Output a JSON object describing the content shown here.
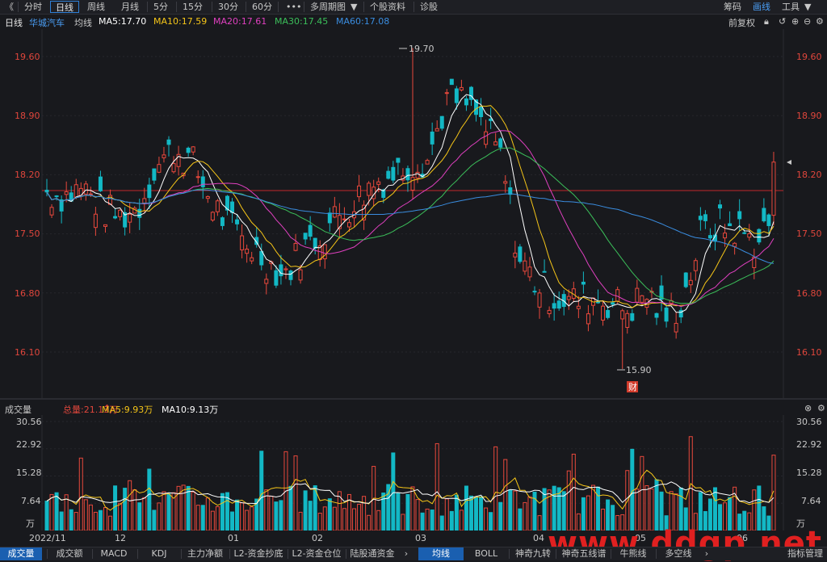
{
  "toolbar": {
    "back": "《",
    "periods": [
      "分时",
      "日线",
      "周线",
      "月线",
      "5分",
      "15分",
      "30分",
      "60分",
      "•••",
      "多周期图",
      "个股资料",
      "诊股"
    ],
    "active_period": "日线",
    "right": [
      "筹码",
      "画线",
      "工具"
    ],
    "right_active": "画线"
  },
  "info": {
    "period": "日线",
    "stock_name": "华城汽车",
    "ma_label": "均线",
    "ma5": "MA5:17.70",
    "ma10": "MA10:17.59",
    "ma20": "MA20:17.61",
    "ma30": "MA30:17.45",
    "ma60": "MA60:17.08",
    "fuquan": "前复权",
    "colors": {
      "ma5": "#ffffff",
      "ma10": "#f5c518",
      "ma20": "#e040c0",
      "ma30": "#3bbf5a",
      "ma60": "#3a8de0"
    }
  },
  "price_axis": [
    "19.60",
    "18.90",
    "18.20",
    "17.50",
    "16.80",
    "16.10"
  ],
  "annotations": {
    "high": "19.70",
    "low": "15.90",
    "marker": "财"
  },
  "volume": {
    "title": "成交量",
    "total": "总量:21.13万",
    "ma5": "MA5:9.93万",
    "ma10": "MA10:9.13万",
    "axis": [
      "30.56",
      "22.92",
      "15.28",
      "7.64",
      "万"
    ]
  },
  "dates": [
    "2022/11",
    "12",
    "01",
    "02",
    "03",
    "04",
    "05",
    "06"
  ],
  "bottom_tabs_left": [
    "成交量",
    "成交额",
    "MACD",
    "KDJ",
    "主力净额",
    "L2-资金抄底",
    "L2-资金仓位",
    "陆股通资金"
  ],
  "bottom_tabs_right": [
    "均线",
    "BOLL",
    "神奇九转",
    "神奇五线谱",
    "牛熊线",
    "多空线",
    "指标管理"
  ],
  "watermark": "www.ddgp.net",
  "chart_data": {
    "type": "candlestick",
    "x": [
      "2022/11",
      "12",
      "01",
      "02",
      "03",
      "04",
      "05",
      "06"
    ],
    "ylim": [
      15.8,
      19.8
    ],
    "reference_price": 18.0,
    "high": 19.7,
    "low": 15.9,
    "last_close": 18.35,
    "ma5_curve": [
      18.0,
      17.95,
      18.05,
      17.8,
      17.7,
      17.8,
      18.3,
      18.5,
      18.35,
      17.9,
      17.6,
      17.4,
      17.2,
      17.0,
      17.3,
      17.5,
      17.7,
      17.9,
      18.1,
      18.2,
      18.35,
      18.4,
      19.1,
      19.05,
      18.8,
      18.4,
      17.2,
      16.9,
      16.75,
      16.7,
      16.75,
      16.7,
      16.6,
      16.8,
      16.5,
      16.7,
      17.5,
      17.6,
      17.55,
      17.4,
      17.7
    ]
  }
}
